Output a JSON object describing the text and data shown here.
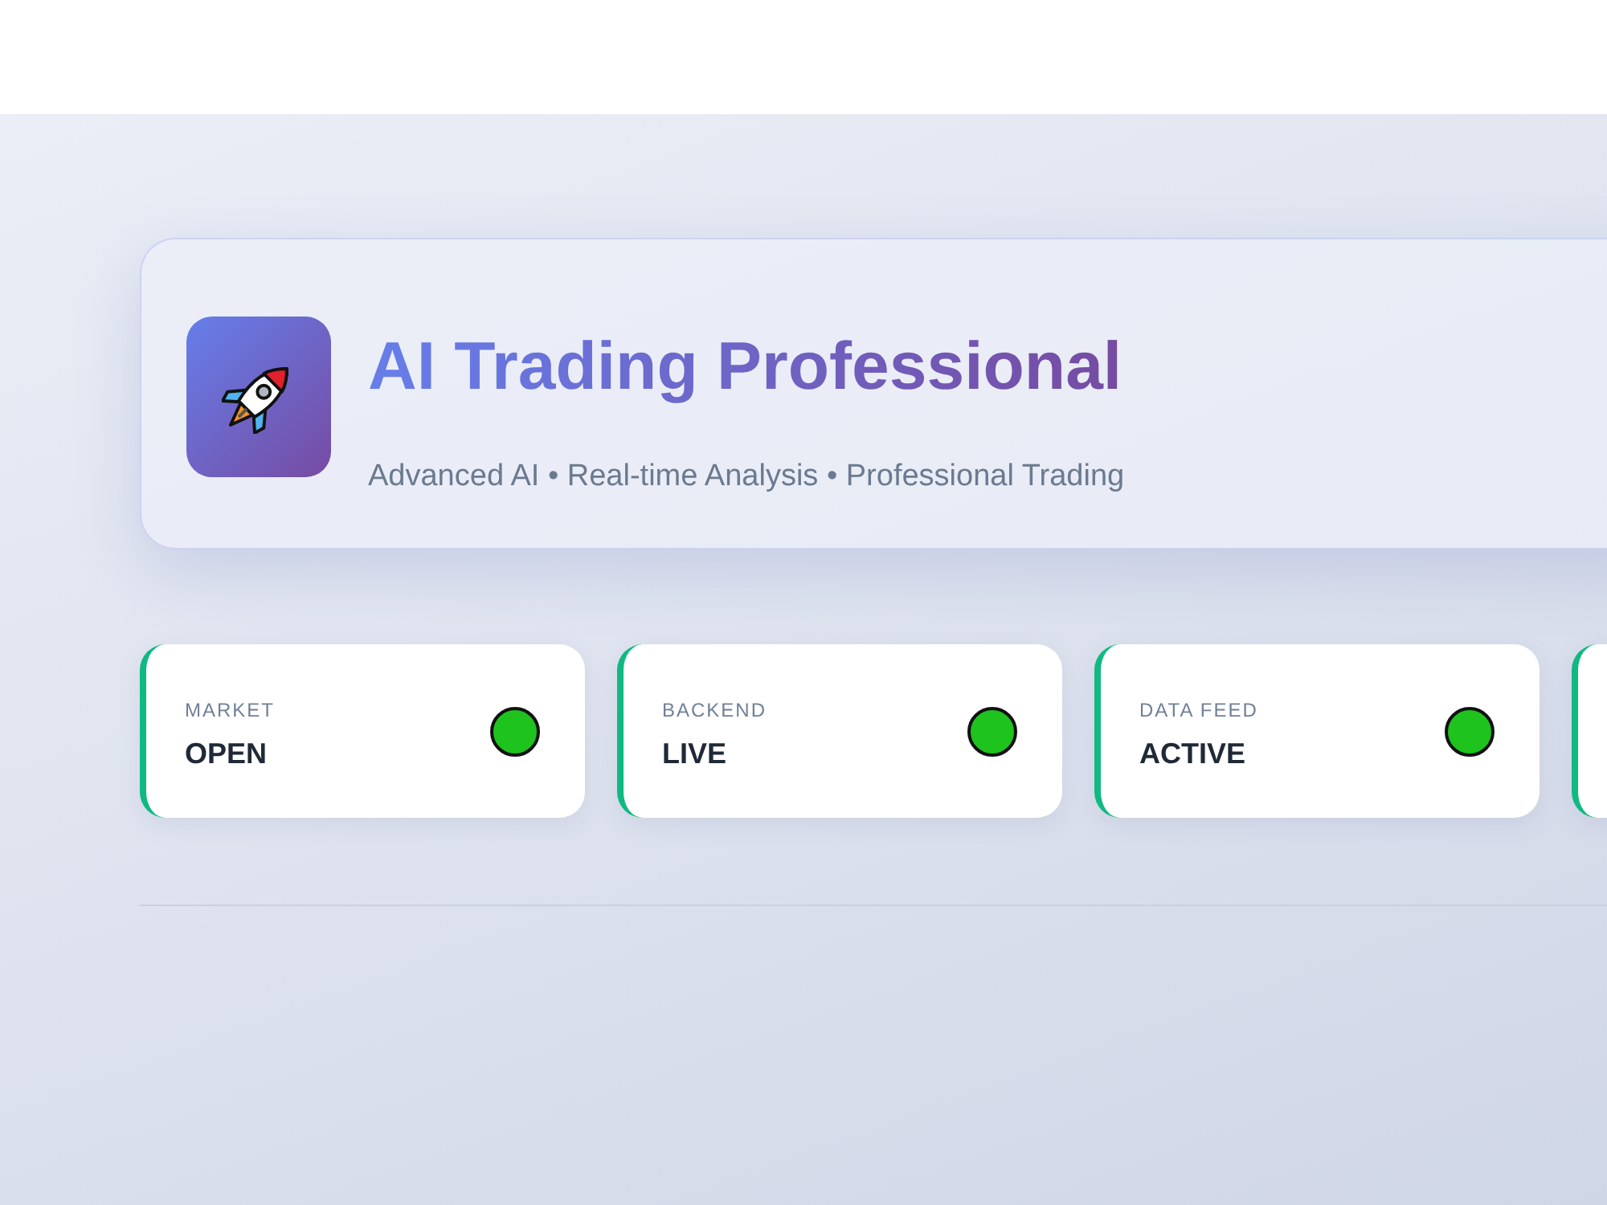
{
  "header": {
    "title": "AI Trading Professional",
    "subtitle": "Advanced AI • Real-time Analysis • Professional Trading"
  },
  "status_cards": [
    {
      "kind": "status",
      "label": "MARKET",
      "value": "OPEN",
      "color": "#1ec31e"
    },
    {
      "kind": "status",
      "label": "BACKEND",
      "value": "LIVE",
      "color": "#1ec31e"
    },
    {
      "kind": "status",
      "label": "DATA FEED",
      "value": "ACTIVE",
      "color": "#1ec31e"
    },
    {
      "kind": "clipped"
    }
  ]
}
